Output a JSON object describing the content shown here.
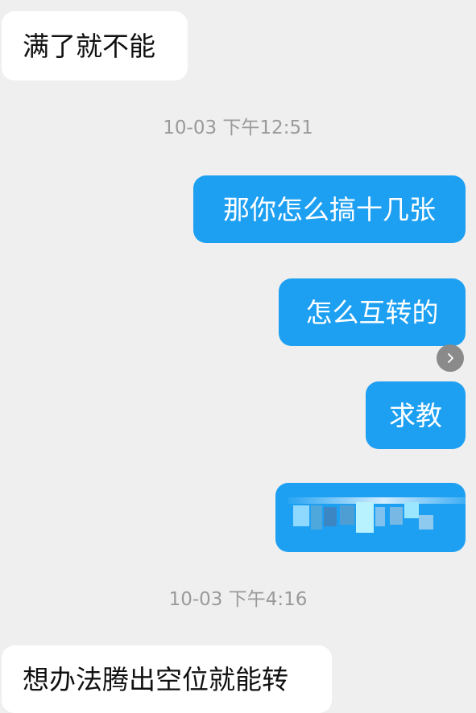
{
  "messages": {
    "incoming_1": "满了就不能",
    "timestamp_1": "10-03 下午12:51",
    "outgoing_1": "那你怎么搞十几张",
    "outgoing_2": "怎么互转的",
    "outgoing_3": "求教",
    "timestamp_2": "10-03 下午4:16",
    "incoming_2": "想办法腾出空位就能转"
  },
  "icons": {
    "forward": "chevron-right-icon"
  },
  "colors": {
    "background": "#efefef",
    "incoming_bubble": "#ffffff",
    "outgoing_bubble": "#1ea0f2",
    "timestamp_text": "#9a9a9a"
  }
}
